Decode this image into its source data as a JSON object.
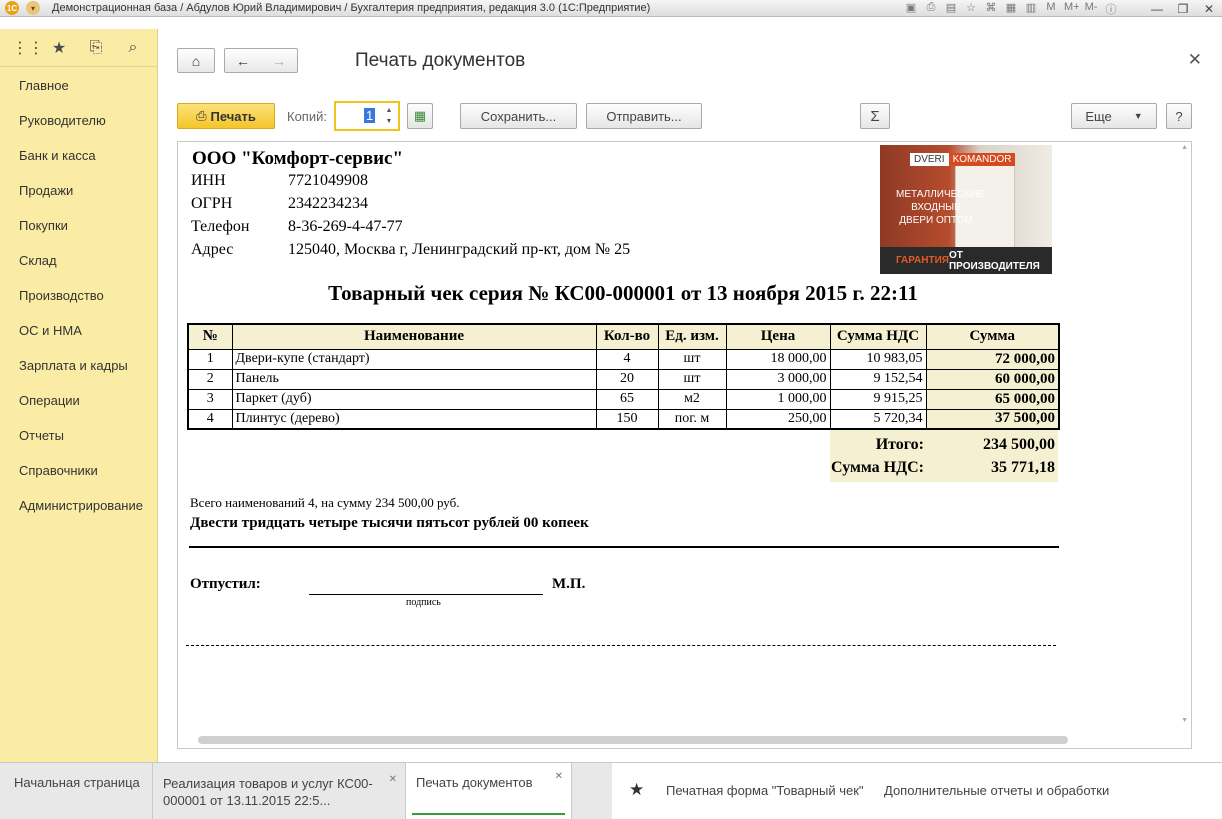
{
  "window": {
    "title": "Демонстрационная база / Абдулов Юрий Владимирович / Бухгалтерия предприятия, редакция 3.0  (1С:Предприятие)",
    "logo": "1С",
    "tool_labels": [
      "M",
      "M+",
      "M-"
    ]
  },
  "sidebar": {
    "items": [
      {
        "label": "Главное"
      },
      {
        "label": "Руководителю"
      },
      {
        "label": "Банк и касса"
      },
      {
        "label": "Продажи"
      },
      {
        "label": "Покупки"
      },
      {
        "label": "Склад"
      },
      {
        "label": "Производство"
      },
      {
        "label": "ОС и НМА"
      },
      {
        "label": "Зарплата и кадры"
      },
      {
        "label": "Операции"
      },
      {
        "label": "Отчеты"
      },
      {
        "label": "Справочники"
      },
      {
        "label": "Администрирование"
      }
    ]
  },
  "form": {
    "title": "Печать документов",
    "print_label": "Печать",
    "copies_label": "Копий:",
    "copies_value": "1",
    "save_label": "Сохранить...",
    "send_label": "Отправить...",
    "sum_symbol": "Σ",
    "more_label": "Еще",
    "help_label": "?"
  },
  "document": {
    "org_name": "ООО \"Комфорт-сервис\"",
    "fields": [
      {
        "label": "ИНН",
        "value": "7721049908"
      },
      {
        "label": "ОГРН",
        "value": "2342234234"
      },
      {
        "label": "Телефон",
        "value": "8-36-269-4-47-77"
      },
      {
        "label": "Адрес",
        "value": "125040, Москва г, Ленинградский пр-кт, дом № 25"
      }
    ],
    "ad": {
      "brand_a": "DVERI",
      "brand_b": "KOMANDOR",
      "text": "МЕТАЛЛИЧЕСКИЕ ВХОДНЫЕ ДВЕРИ ОПТОМ",
      "bottom_red": "ГАРАНТИЯ",
      "bottom_white": " ОТ ПРОИЗВОДИТЕЛЯ"
    },
    "doc_title": "Товарный чек серия № КС00-000001 от 13 ноября 2015 г. 22:11",
    "columns": [
      "№",
      "Наименование",
      "Кол-во",
      "Ед. изм.",
      "Цена",
      "Сумма НДС",
      "Сумма"
    ],
    "rows": [
      [
        "1",
        "Двери-купе (стандарт)",
        "4",
        "шт",
        "18 000,00",
        "10 983,05",
        "72 000,00"
      ],
      [
        "2",
        "Панель",
        "20",
        "шт",
        "3 000,00",
        "9 152,54",
        "60 000,00"
      ],
      [
        "3",
        "Паркет (дуб)",
        "65",
        "м2",
        "1 000,00",
        "9 915,25",
        "65 000,00"
      ],
      [
        "4",
        "Плинтус (дерево)",
        "150",
        "пог. м",
        "250,00",
        "5 720,34",
        "37 500,00"
      ]
    ],
    "total_label": "Итого:",
    "total_value": "234 500,00",
    "vat_label": "Сумма НДС:",
    "vat_value": "35 771,18",
    "summary_line": "Всего наименований 4, на сумму 234 500,00 руб.",
    "amount_words": "Двести тридцать четыре тысячи пятьсот рублей 00 копеек",
    "released_label": "Отпустил:",
    "signature_caption": "подпись",
    "stamp_label": "М.П."
  },
  "tabs": [
    {
      "label": "Начальная страница"
    },
    {
      "label": "Реализация товаров и услуг КС00-000001 от 13.11.2015 22:5..."
    },
    {
      "label": "Печать документов"
    }
  ],
  "bottom_links": {
    "print_form": "Печатная форма \"Товарный чек\"",
    "extra_reports": "Дополнительные отчеты и обработки"
  }
}
